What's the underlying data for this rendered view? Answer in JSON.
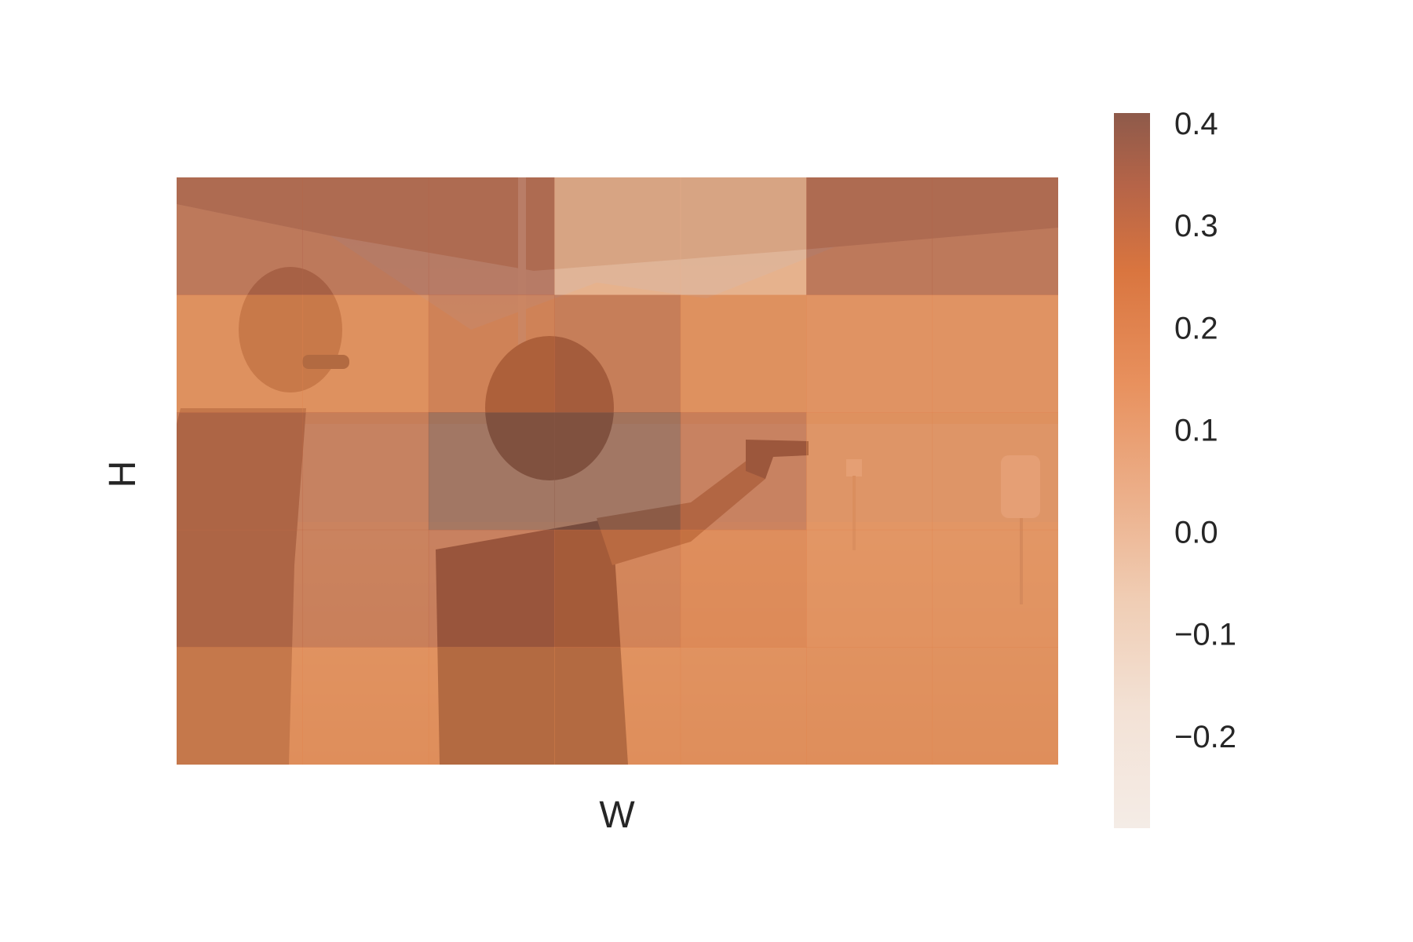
{
  "chart_data": {
    "type": "heatmap",
    "title": "",
    "xlabel": "W",
    "ylabel": "H",
    "rows": 5,
    "cols": 7,
    "values": [
      [
        0.3,
        0.3,
        0.3,
        -0.06,
        -0.06,
        0.3,
        0.3
      ],
      [
        0.12,
        0.12,
        0.22,
        0.26,
        0.12,
        0.1,
        0.1
      ],
      [
        0.26,
        0.26,
        0.45,
        0.42,
        0.25,
        0.12,
        0.12
      ],
      [
        0.26,
        0.26,
        0.27,
        0.22,
        0.16,
        0.12,
        0.12
      ],
      [
        0.12,
        0.12,
        0.12,
        0.12,
        0.12,
        0.12,
        0.12
      ]
    ],
    "colorbar": {
      "ticks": [
        "0.4",
        "0.3",
        "0.2",
        "0.1",
        "0.0",
        "−0.1",
        "−0.2"
      ],
      "tick_values": [
        0.4,
        0.3,
        0.2,
        0.1,
        0.0,
        -0.1,
        -0.2
      ],
      "vmin": -0.29,
      "vmax": 0.41,
      "colormap": [
        "#f4ece6",
        "#f3d7c3",
        "#ecb08b",
        "#e8915e",
        "#d9753f",
        "#b56448",
        "#8e5a4a"
      ]
    },
    "grid": false,
    "background": "photo: two people at an outdoor shooting range, one aiming a revolver"
  },
  "icons": {
    "overlay-image": "photo-scene"
  }
}
